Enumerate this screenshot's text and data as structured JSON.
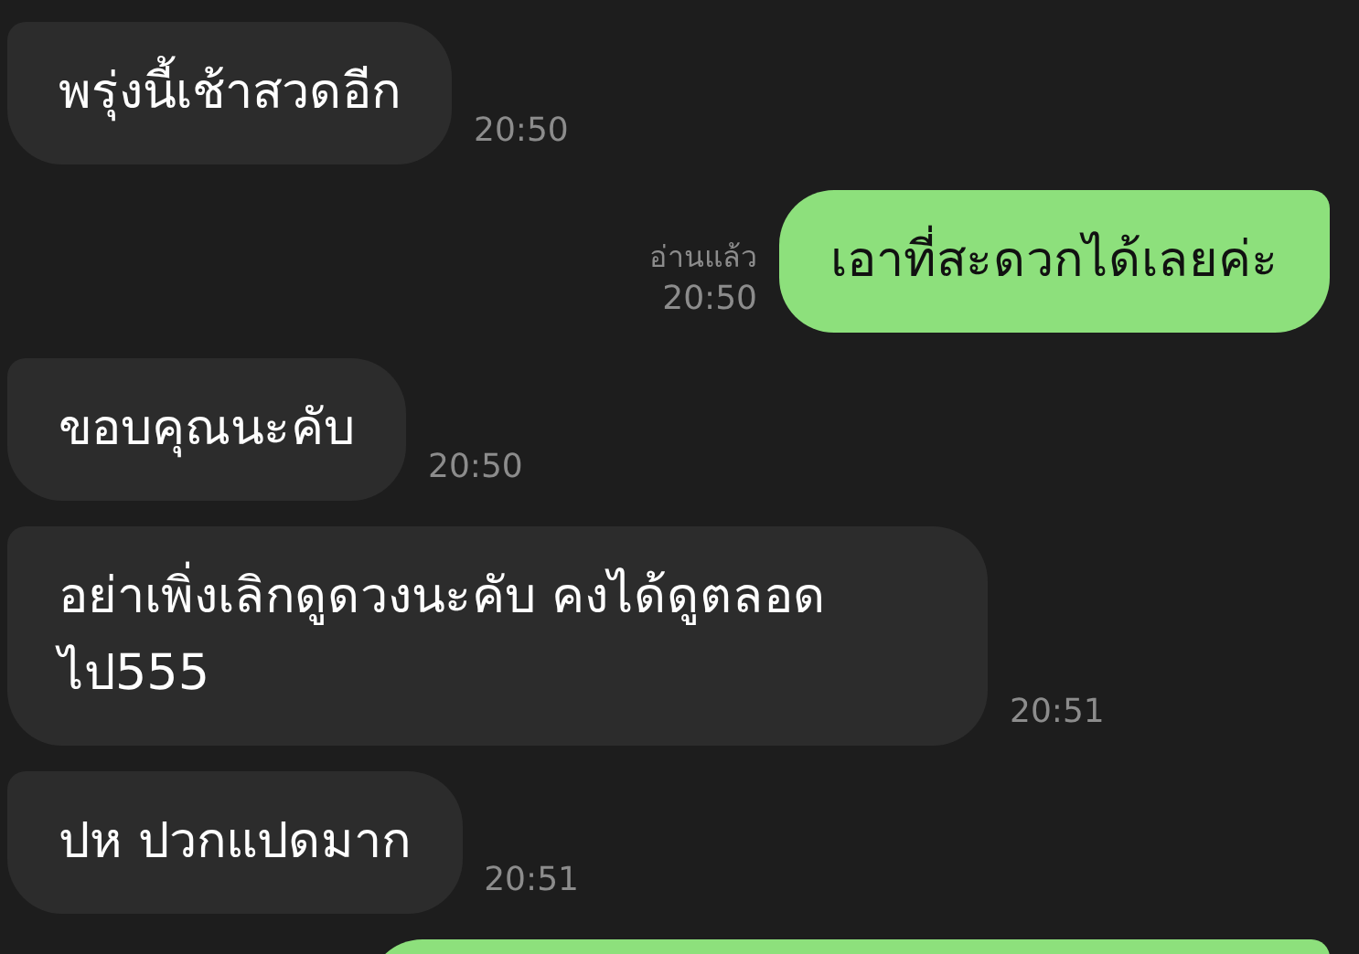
{
  "messages": [
    {
      "kind": "incoming",
      "text": "พรุ่งนี้เช้าสวดอีก",
      "time": "20:50"
    },
    {
      "kind": "outgoing",
      "text": "เอาที่สะดวกได้เลยค่ะ",
      "read": "อ่านแล้ว",
      "time": "20:50"
    },
    {
      "kind": "incoming",
      "text": "ขอบคุณนะคับ",
      "time": "20:50"
    },
    {
      "kind": "incoming",
      "text": "อย่าเพิ่งเลิกดูดวงนะคับ คงได้ดูตลอดไป555",
      "time": "20:51"
    },
    {
      "kind": "incoming",
      "text": "ปห ปวกแปดมาก",
      "time": "20:51"
    },
    {
      "kind": "outgoing"
    }
  ]
}
